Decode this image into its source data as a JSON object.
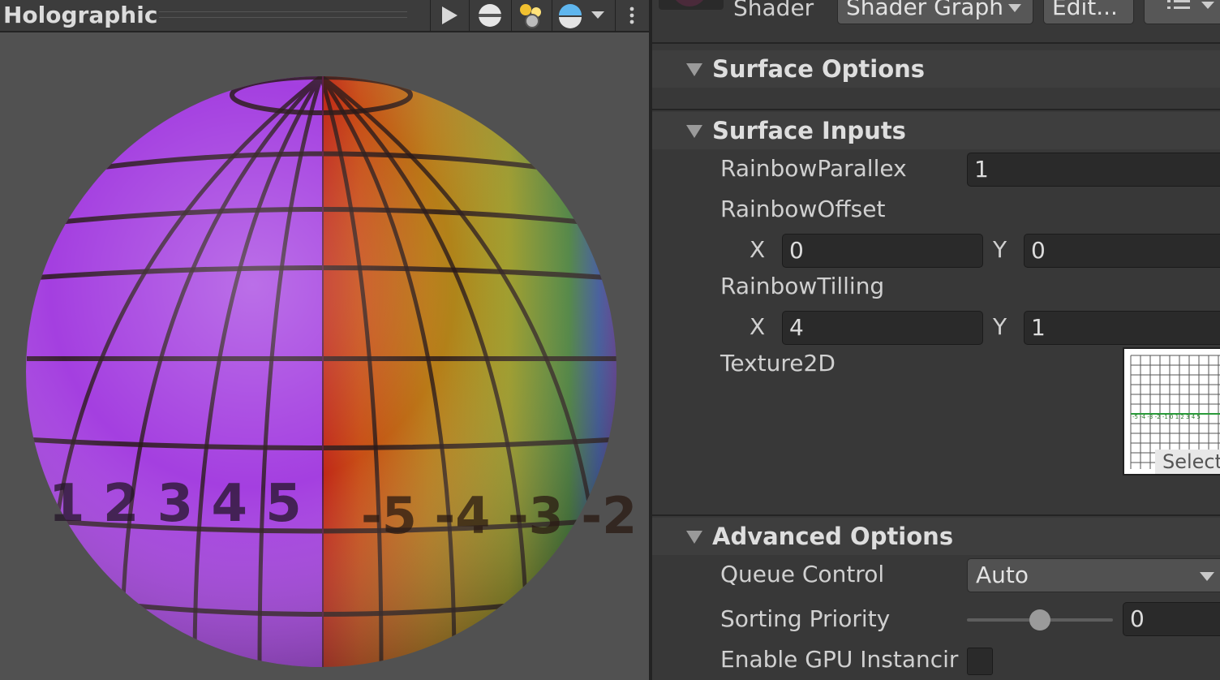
{
  "preview": {
    "title": "Holographic",
    "toolbar": [
      "play-icon",
      "sphere-icon",
      "lights-icon",
      "skybox-icon",
      "chevron-down-icon",
      "kebab-menu-icon"
    ],
    "sphere_labels": {
      "left": "1 2 3 4 5",
      "right": "-5 -4 -3 -2"
    }
  },
  "header": {
    "shader_label": "Shader",
    "shader_value": "Shader Graph",
    "edit_label": "Edit...",
    "menu_icon": "list-icon"
  },
  "sections": {
    "surface_options": "Surface Options",
    "surface_inputs": "Surface Inputs",
    "advanced_options": "Advanced Options"
  },
  "fields": {
    "rainbow_parallex": {
      "label": "RainbowParallex",
      "value": "1"
    },
    "rainbow_offset": {
      "label": "RainbowOffset",
      "x_label": "X",
      "x": "0",
      "y_label": "Y",
      "y": "0"
    },
    "rainbow_tilling": {
      "label": "RainbowTilling",
      "x_label": "X",
      "x": "4",
      "y_label": "Y",
      "y": "1"
    },
    "texture2d": {
      "label": "Texture2D",
      "select": "Select",
      "texture_text": "-5 -4 -3 -2 -1 0 1 2 3 4 5"
    },
    "queue_control": {
      "label": "Queue Control",
      "value": "Auto"
    },
    "sorting_priority": {
      "label": "Sorting Priority",
      "value": "0",
      "slider_fraction": 0.5
    },
    "gpu_instancing": {
      "label": "Enable GPU Instancir",
      "checked": false
    }
  },
  "colors": {
    "accent_purple": "#a43fe0",
    "panel_bg": "#383838",
    "preview_bg": "#515151",
    "field_bg": "#2a2a2a"
  }
}
